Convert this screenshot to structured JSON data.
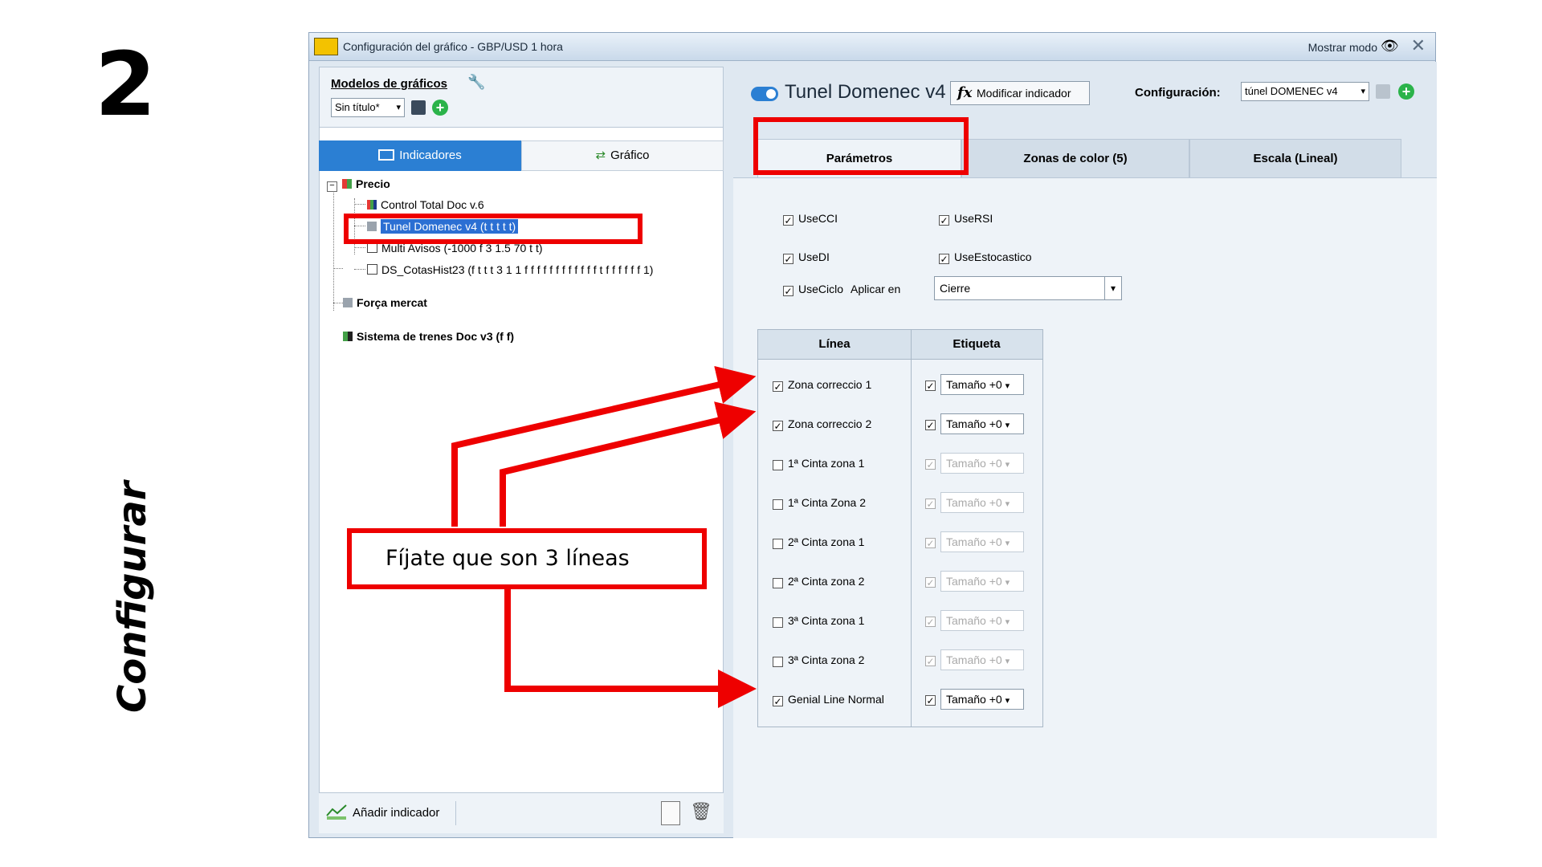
{
  "slide": {
    "step_number": "2",
    "side_title": "Configurar"
  },
  "window": {
    "title": "Configuración del gráfico - GBP/USD 1 hora",
    "show_mode_label": "Mostrar modo"
  },
  "left": {
    "models_label": "Modelos de gráficos",
    "model_select": "Sin título*",
    "tabs": {
      "indicators": "Indicadores",
      "chart": "Gráfico"
    },
    "tree": {
      "precio": "Precio",
      "items": [
        "Control Total Doc v.6",
        "Tunel Domenec v4 (t t t t t)",
        "Multi Avisos (-1000 f 3 1.5 70 t t)",
        "DS_CotasHist23 (f t t t 3 1 1 f f f f f f f f f f f f t f f f f f f 1)"
      ],
      "forca": "Força mercat",
      "sistema": "Sistema de trenes Doc v3 (f f)"
    },
    "add_indicator": "Añadir indicador"
  },
  "right": {
    "indicator_name": "Tunel Domenec v4",
    "modify_button": "Modificar indicador",
    "config_label": "Configuración:",
    "config_select": "túnel DOMENEC v4",
    "tabs": [
      "Parámetros",
      "Zonas de color (5)",
      "Escala (Lineal)"
    ],
    "params": {
      "usecci": "UseCCI",
      "usersi": "UseRSI",
      "usedi": "UseDI",
      "useestocastico": "UseEstocastico",
      "useciclo": "UseCiclo",
      "aplicar_label": "Aplicar en",
      "aplicar_value": "Cierre"
    },
    "grid": {
      "col_linea": "Línea",
      "col_etiqueta": "Etiqueta",
      "size_value": "Tamaño +0",
      "rows": [
        {
          "label": "Zona correccio 1",
          "checked": true
        },
        {
          "label": "Zona correccio 2",
          "checked": true
        },
        {
          "label": "1ª Cinta zona 1",
          "checked": false
        },
        {
          "label": "1ª Cinta Zona 2",
          "checked": false
        },
        {
          "label": "2ª Cinta zona 1",
          "checked": false
        },
        {
          "label": "2ª Cinta zona 2",
          "checked": false
        },
        {
          "label": "3ª Cinta zona 1",
          "checked": false
        },
        {
          "label": "3ª Cinta zona 2",
          "checked": false
        },
        {
          "label": "Genial Line Normal",
          "checked": true
        }
      ]
    }
  },
  "annotation": {
    "note": "Fíjate que son 3 líneas"
  },
  "colors": {
    "accent": "#2b7fd3",
    "highlight": "#ee0000",
    "panel": "#dfe8f1"
  }
}
